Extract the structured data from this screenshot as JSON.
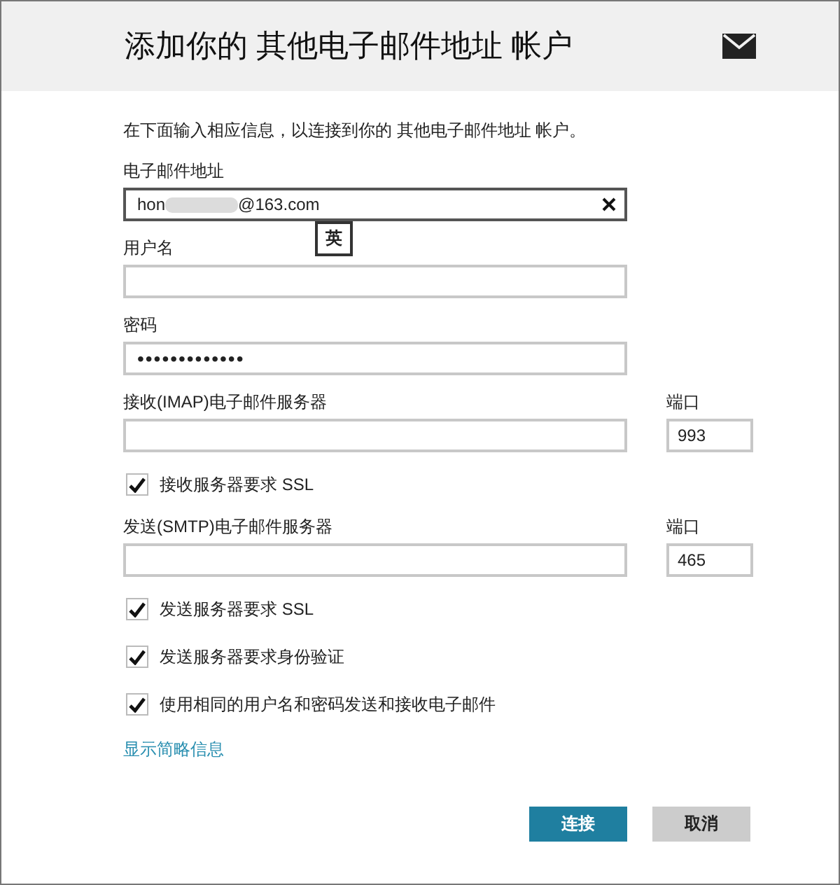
{
  "window": {
    "title": "添加你的 其他电子邮件地址 帐户",
    "intro": "在下面输入相应信息，以连接到你的 其他电子邮件地址 帐户。"
  },
  "form": [
    {
      "kind": "email",
      "label": "电子邮件地址",
      "value_start": "hon",
      "value_end": "@163.com",
      "ime_indicator": "英"
    },
    {
      "kind": "text",
      "label": "用户名"
    },
    {
      "kind": "password",
      "label": "密码",
      "value": "•••••••••••••"
    },
    {
      "kind": "server",
      "label": "接收(IMAP)电子邮件服务器",
      "port_label": "端口",
      "port": "993"
    },
    {
      "kind": "checkbox",
      "label": "接收服务器要求 SSL",
      "checked": true
    },
    {
      "kind": "server",
      "label": "发送(SMTP)电子邮件服务器",
      "port_label": "端口",
      "port": "465"
    },
    {
      "kind": "checkbox",
      "label": "发送服务器要求 SSL",
      "checked": true
    },
    {
      "kind": "checkbox",
      "label": "发送服务器要求身份验证",
      "checked": true
    },
    {
      "kind": "checkbox",
      "label": "使用相同的用户名和密码发送和接收电子邮件",
      "checked": true
    }
  ],
  "link": "显示简略信息",
  "buttons": [
    {
      "label": "连接",
      "primary": true
    },
    {
      "label": "取消",
      "primary": false
    }
  ]
}
